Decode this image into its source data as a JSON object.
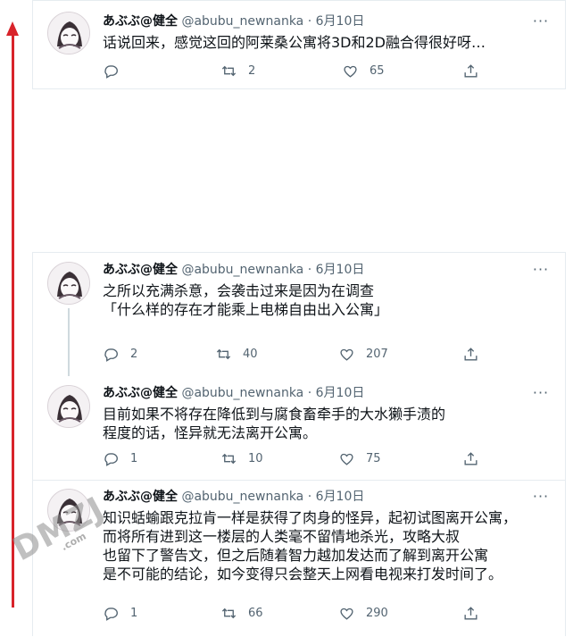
{
  "tweets": [
    {
      "display_name": "あぶぶ@健全",
      "handle": "@abubu_newnanka",
      "separator": "·",
      "date": "6月10日",
      "lines": [
        "话说回来，感觉这回的阿莱桑公寓将3D和2D融合得很好呀…"
      ],
      "reply_count": "",
      "retweet_count": "2",
      "like_count": "65"
    },
    {
      "display_name": "あぶぶ@健全",
      "handle": "@abubu_newnanka",
      "separator": "·",
      "date": "6月10日",
      "lines": [
        "之所以充满杀意，会袭击过来是因为在调查",
        "「什么样的存在才能乘上电梯自由出入公寓」"
      ],
      "reply_count": "2",
      "retweet_count": "40",
      "like_count": "207"
    },
    {
      "display_name": "あぶぶ@健全",
      "handle": "@abubu_newnanka",
      "separator": "·",
      "date": "6月10日",
      "lines": [
        "目前如果不将存在降低到与腐食畜牵手的大水獭手渍的",
        "程度的话，怪异就无法离开公寓。"
      ],
      "reply_count": "1",
      "retweet_count": "10",
      "like_count": "75"
    },
    {
      "display_name": "あぶぶ@健全",
      "handle": "@abubu_newnanka",
      "separator": "·",
      "date": "6月10日",
      "lines": [
        "知识蛞蝓跟克拉肯一样是获得了肉身的怪异，起初试图离开公寓，",
        "而将所有进到这一楼层的人类毫不留情地杀光，攻略大叔",
        "也留下了警告文，但之后随着智力越加发达而了解到离开公寓",
        "是不可能的结论，如今变得只会整天上网看电视来打发时间了。"
      ],
      "reply_count": "1",
      "retweet_count": "66",
      "like_count": "290"
    }
  ],
  "watermark": {
    "main": "DMZJ",
    "sub": ".com"
  },
  "colors": {
    "text": "#0f1419",
    "muted": "#536471",
    "border": "#e6ecf0",
    "arrow": "#d8232a",
    "thread": "#cfd9de"
  },
  "icons": [
    "reply-icon",
    "retweet-icon",
    "like-icon",
    "share-icon",
    "more-icon"
  ]
}
